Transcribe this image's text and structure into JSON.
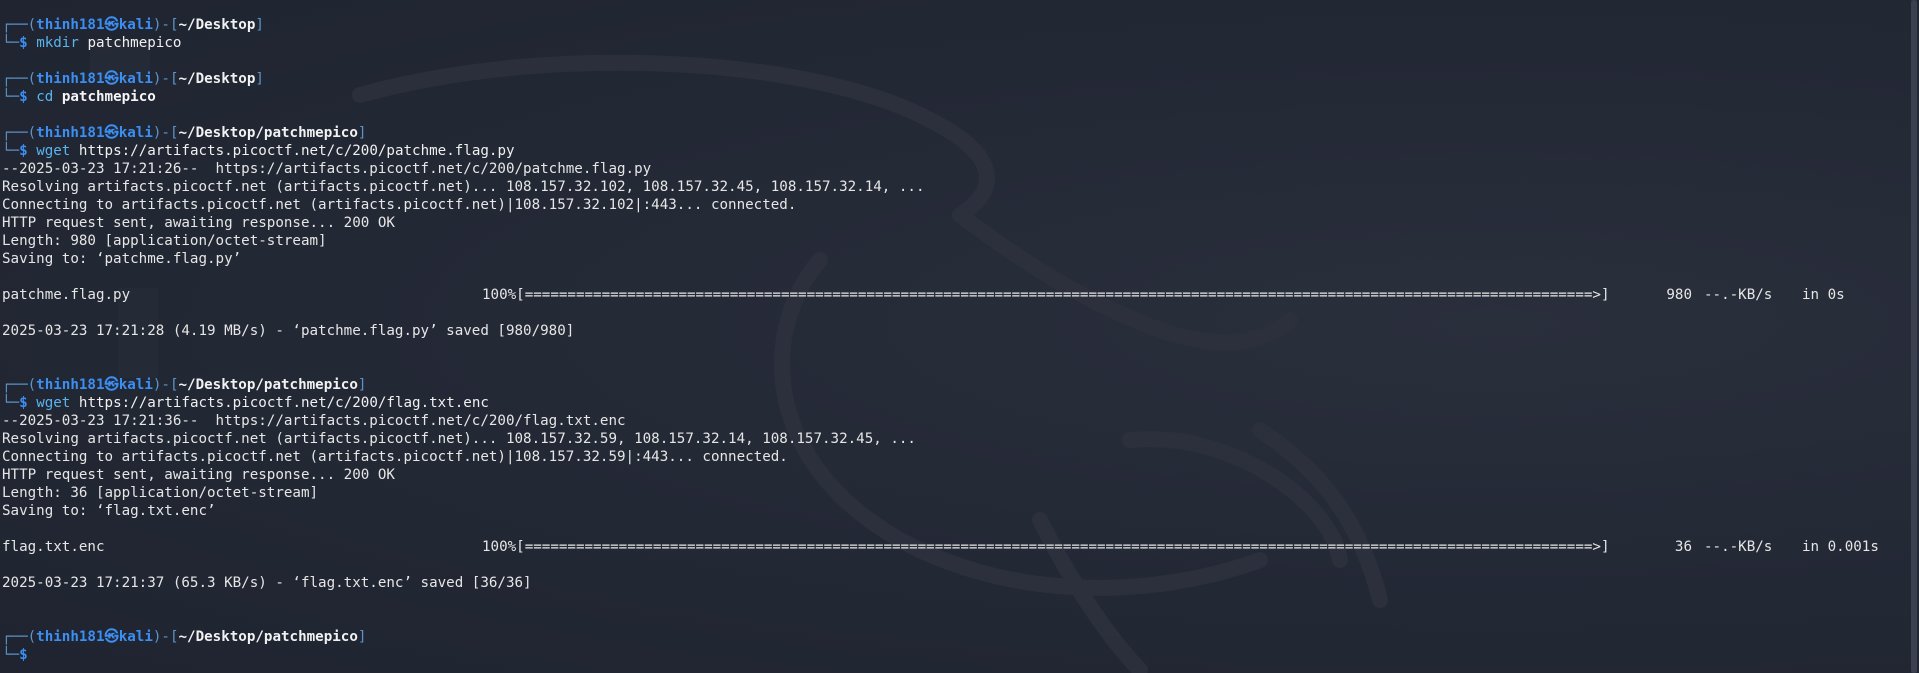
{
  "colors": {
    "background": "#232835",
    "frame": "#5b95c8",
    "user": "#3c8ff2",
    "command": "#59b4ef",
    "text": "#e6e6e6"
  },
  "prompt": {
    "open": "┌──(",
    "user_host": "thinh181㉿kali",
    "mid": ")-[",
    "close": "]",
    "corner": "└─",
    "dollar": "$"
  },
  "session": [
    {
      "path": "~/Desktop",
      "cmd": "mkdir",
      "arg": "patchmepico",
      "arg_bold": false,
      "output": []
    },
    {
      "path": "~/Desktop",
      "cmd": "cd",
      "arg": "patchmepico",
      "arg_bold": true,
      "output": []
    },
    {
      "path": "~/Desktop/patchmepico",
      "cmd": "wget",
      "arg": "https://artifacts.picoctf.net/c/200/patchme.flag.py",
      "arg_bold": false,
      "output": [
        "--2025-03-23 17:21:26--  https://artifacts.picoctf.net/c/200/patchme.flag.py",
        "Resolving artifacts.picoctf.net (artifacts.picoctf.net)... 108.157.32.102, 108.157.32.45, 108.157.32.14, ...",
        "Connecting to artifacts.picoctf.net (artifacts.picoctf.net)|108.157.32.102|:443... connected.",
        "HTTP request sent, awaiting response... 200 OK",
        "Length: 980 [application/octet-stream]",
        "Saving to: ‘patchme.flag.py’"
      ],
      "progress": {
        "file": "patchme.flag.py",
        "bar": "100%[=============================================================================================================================>]",
        "size": "980",
        "speed": "--.-KB/s",
        "time": "in 0s"
      },
      "saved": "2025-03-23 17:21:28 (4.19 MB/s) - ‘patchme.flag.py’ saved [980/980]"
    },
    {
      "path": "~/Desktop/patchmepico",
      "cmd": "wget",
      "arg": "https://artifacts.picoctf.net/c/200/flag.txt.enc",
      "arg_bold": false,
      "output": [
        "--2025-03-23 17:21:36--  https://artifacts.picoctf.net/c/200/flag.txt.enc",
        "Resolving artifacts.picoctf.net (artifacts.picoctf.net)... 108.157.32.59, 108.157.32.14, 108.157.32.45, ...",
        "Connecting to artifacts.picoctf.net (artifacts.picoctf.net)|108.157.32.59|:443... connected.",
        "HTTP request sent, awaiting response... 200 OK",
        "Length: 36 [application/octet-stream]",
        "Saving to: ‘flag.txt.enc’"
      ],
      "progress": {
        "file": "flag.txt.enc",
        "bar": "100%[=============================================================================================================================>]",
        "size": "36",
        "speed": "--.-KB/s",
        "time": "in 0.001s"
      },
      "saved": "2025-03-23 17:21:37 (65.3 KB/s) - ‘flag.txt.enc’ saved [36/36]"
    }
  ],
  "final_prompt": {
    "path": "~/Desktop/patchmepico"
  }
}
